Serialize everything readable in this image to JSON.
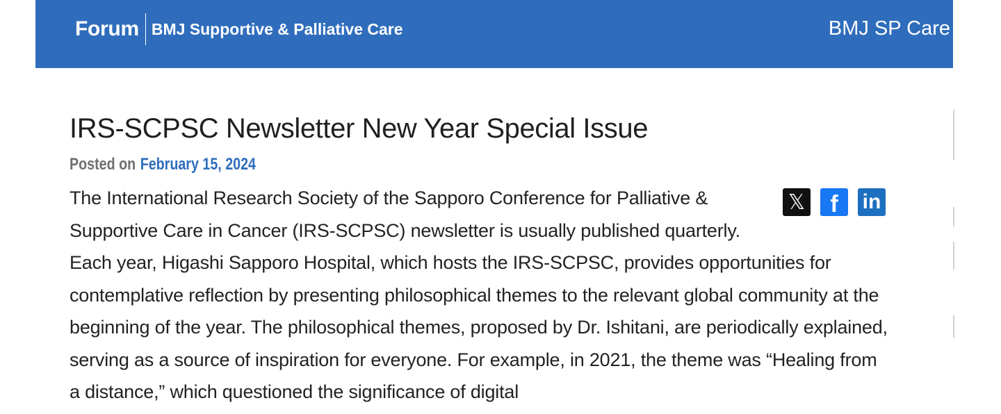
{
  "header": {
    "brand_forum": "Forum",
    "brand_journal": "BMJ Supportive & Palliative Care",
    "right_link": "BMJ SP Care",
    "background_color": "#2f6dbc"
  },
  "article": {
    "title": "IRS-SCPSC Newsletter New Year Special Issue",
    "posted_label": "Posted on",
    "posted_date": "February 15, 2024",
    "paragraph1": "The International Research Society of the Sapporo Conference for Palliative & Supportive Care in Cancer (IRS-SCPSC) newsletter is usually published quarterly.",
    "paragraph2": "Each year, Higashi Sapporo Hospital, which hosts the IRS-SCPSC, provides opportunities for contemplative reflection by presenting philosophical themes to the relevant global community at the beginning of the year. The philosophical themes, proposed by Dr. Ishitani, are periodically explained, serving as a source of inspiration for everyone. For example, in 2021, the theme was “Healing from a distance,” which questioned the significance of digital"
  },
  "share": {
    "x": {
      "icon": "x-icon",
      "glyph": "𝕏",
      "color": "#111111"
    },
    "facebook": {
      "icon": "facebook-icon",
      "glyph": "f",
      "color": "#1877f2"
    },
    "linkedin": {
      "icon": "linkedin-icon",
      "glyph": "in",
      "color": "#1d6fc0"
    }
  }
}
